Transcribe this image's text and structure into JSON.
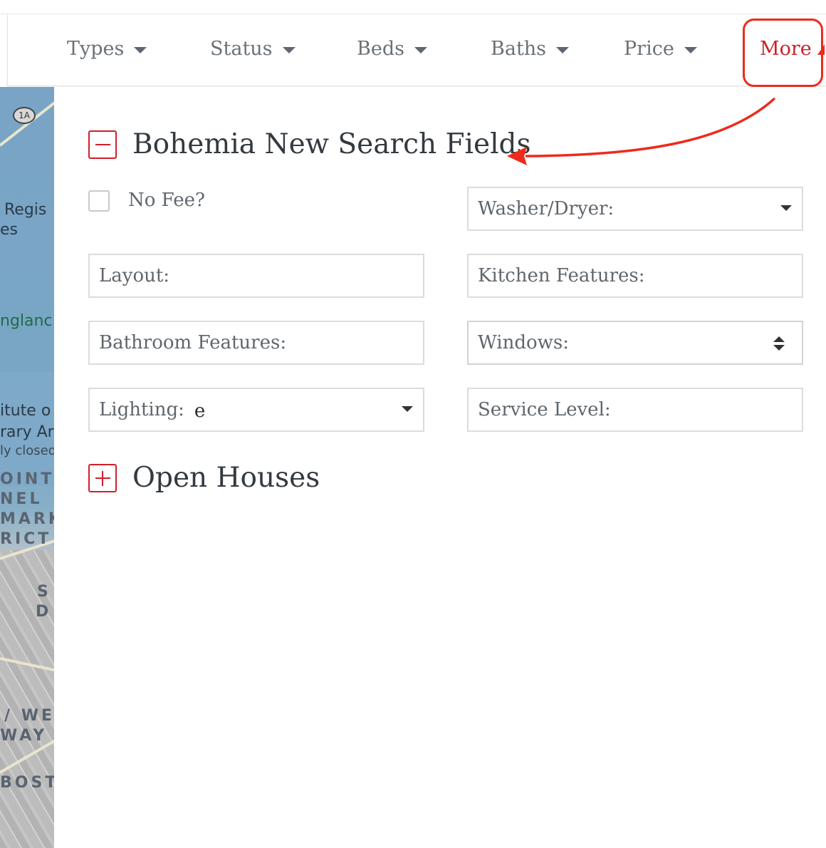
{
  "filters": [
    {
      "label": "Types"
    },
    {
      "label": "Status"
    },
    {
      "label": "Beds"
    },
    {
      "label": "Baths"
    },
    {
      "label": "Price"
    }
  ],
  "more_label": "More",
  "map": {
    "shield": "1A",
    "labels": [
      "Regis",
      "es",
      "nglanc",
      "itute o",
      "rary Ar",
      "ly closed",
      "OINT",
      "NEL",
      "MARK",
      "RICT",
      "S",
      "D",
      "/ WE",
      "WAY",
      "BOST"
    ]
  },
  "sections": {
    "search_fields": {
      "title": "Bohemia New Search Fields",
      "expanded": true
    },
    "open_houses": {
      "title": "Open Houses",
      "expanded": false
    }
  },
  "checkbox": {
    "label": "No Fee?",
    "checked": false
  },
  "fields": {
    "washer_dryer": {
      "placeholder": "Washer/Dryer:"
    },
    "layout": {
      "placeholder": "Layout:"
    },
    "kitchen": {
      "placeholder": "Kitchen Features:"
    },
    "bathroom": {
      "placeholder": "Bathroom Features:"
    },
    "windows": {
      "placeholder": "Windows:"
    },
    "lighting": {
      "placeholder": "Lighting:",
      "value": "e"
    },
    "service": {
      "placeholder": "Service Level:"
    }
  },
  "colors": {
    "accent": "#d21e2b",
    "annotation": "#ee2a1b"
  }
}
